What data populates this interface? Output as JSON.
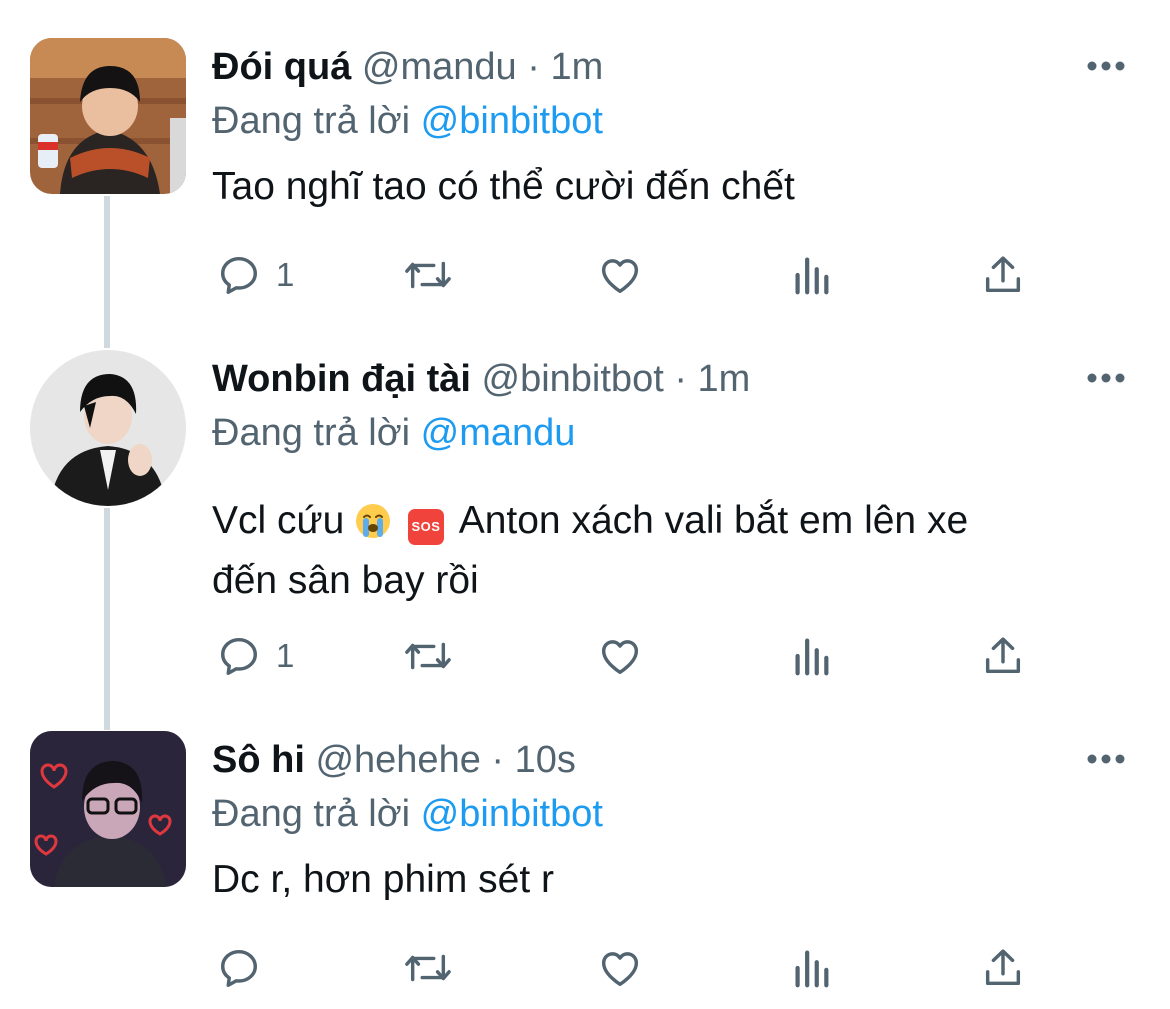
{
  "tweets": [
    {
      "display_name": "Đói quá",
      "handle": "@mandu",
      "dot": "·",
      "time": "1m",
      "replying_prefix": "Đang trả lời",
      "replying_to": "@binbitbot",
      "text": "Tao nghĩ tao có thể cười đến chết",
      "reply_count": "1"
    },
    {
      "display_name": "Wonbin đại tài",
      "handle": "@binbitbot",
      "dot": "·",
      "time": "1m",
      "replying_prefix": "Đang trả lời",
      "replying_to": "@mandu",
      "text_before_emoji": "Vcl cứu",
      "emoji_1": "crying-face",
      "emoji_2": "SOS",
      "text_after_emoji": "Anton xách vali bắt em lên xe",
      "text_line_2": "đến sân bay rồi",
      "reply_count": "1"
    },
    {
      "display_name": "Sô hi",
      "handle": "@hehehe",
      "dot": "·",
      "time": "10s",
      "replying_prefix": "Đang trả lời",
      "replying_to": "@binbitbot",
      "text": "Dc r, hơn phim sét r",
      "reply_count": ""
    }
  ],
  "icons": {
    "reply": "reply-icon",
    "retweet": "retweet-icon",
    "like": "heart-icon",
    "views": "analytics-icon",
    "share": "share-icon",
    "more": "more-icon"
  },
  "colors": {
    "text": "#0f1419",
    "secondary": "#536471",
    "link": "#1d9bf0",
    "thread_line": "#cfd9de"
  }
}
